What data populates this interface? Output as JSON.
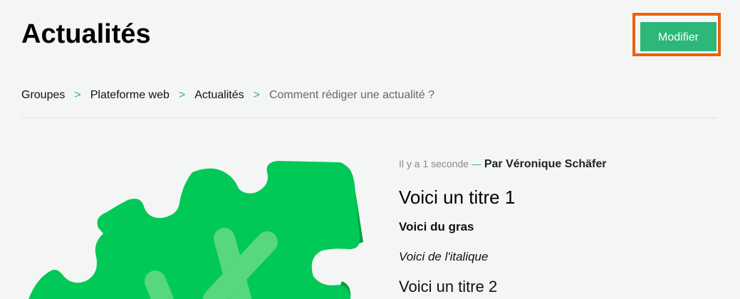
{
  "header": {
    "title": "Actualités",
    "modify_label": "Modifier",
    "highlight_color": "#e9620f",
    "button_color": "#2db779"
  },
  "breadcrumb": {
    "items": [
      "Groupes",
      "Plateforme web",
      "Actualités",
      "Comment rédiger une actualité ?"
    ],
    "separator": ">"
  },
  "article": {
    "time": "Il y a 1 seconde",
    "dash": "—",
    "author": "Par Véronique Schäfer",
    "heading1": "Voici un titre 1",
    "bold_text": "Voici du gras",
    "italic_text": "Voici de l'italique",
    "heading2": "Voici un titre 2"
  },
  "illustration": {
    "icon": "puzzle-piece-icon",
    "main_color": "#00c957",
    "shadow_color": "#00a33e",
    "highlight_color": "#57d77e"
  }
}
